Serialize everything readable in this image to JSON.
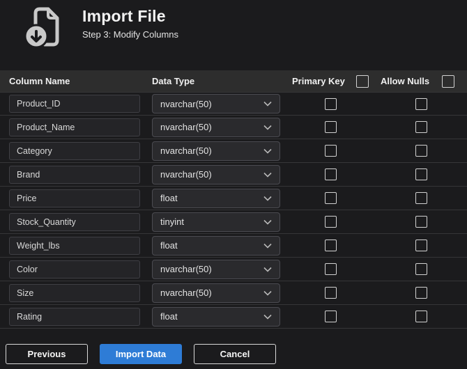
{
  "header": {
    "title": "Import File",
    "subtitle": "Step 3: Modify Columns",
    "icon": "file-download-icon"
  },
  "table": {
    "columns": {
      "name": "Column Name",
      "type": "Data Type",
      "primary_key": "Primary Key",
      "allow_nulls": "Allow Nulls"
    },
    "select_all": {
      "primary_key_checked": false,
      "allow_nulls_checked": false
    },
    "rows": [
      {
        "name": "Product_ID",
        "type": "nvarchar(50)",
        "primary_key": false,
        "allow_nulls": false
      },
      {
        "name": "Product_Name",
        "type": "nvarchar(50)",
        "primary_key": false,
        "allow_nulls": false
      },
      {
        "name": "Category",
        "type": "nvarchar(50)",
        "primary_key": false,
        "allow_nulls": false
      },
      {
        "name": "Brand",
        "type": "nvarchar(50)",
        "primary_key": false,
        "allow_nulls": false
      },
      {
        "name": "Price",
        "type": "float",
        "primary_key": false,
        "allow_nulls": false
      },
      {
        "name": "Stock_Quantity",
        "type": "tinyint",
        "primary_key": false,
        "allow_nulls": false
      },
      {
        "name": "Weight_lbs",
        "type": "float",
        "primary_key": false,
        "allow_nulls": false
      },
      {
        "name": "Color",
        "type": "nvarchar(50)",
        "primary_key": false,
        "allow_nulls": false
      },
      {
        "name": "Size",
        "type": "nvarchar(50)",
        "primary_key": false,
        "allow_nulls": false
      },
      {
        "name": "Rating",
        "type": "float",
        "primary_key": false,
        "allow_nulls": false
      }
    ]
  },
  "footer": {
    "previous_label": "Previous",
    "import_label": "Import Data",
    "cancel_label": "Cancel"
  },
  "colors": {
    "accent_blue": "#2e7cd6",
    "background": "#1b1b1d",
    "table_header": "#2d2d2d"
  }
}
